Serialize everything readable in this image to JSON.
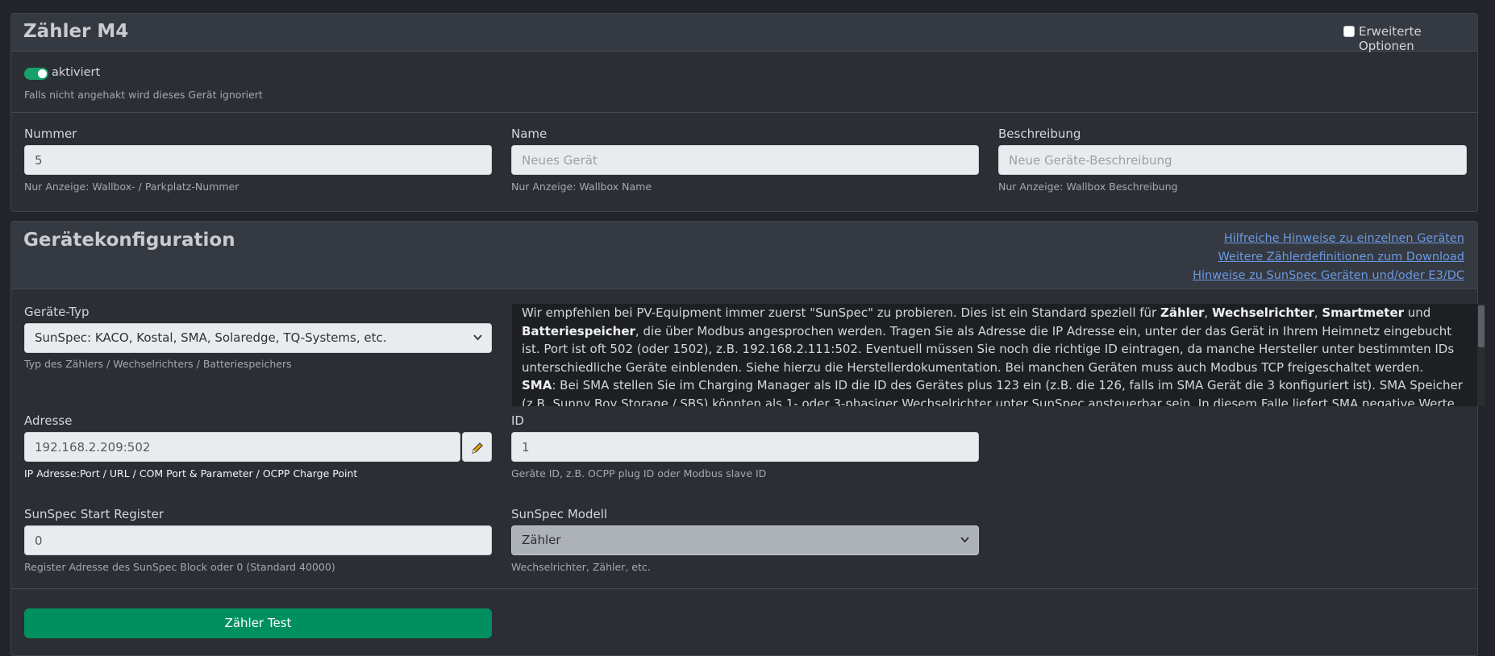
{
  "card1": {
    "title": "Zähler M4",
    "advanced_label": "Erweiterte Optionen",
    "enabled_label": "aktiviert",
    "enabled_hint": "Falls nicht angehakt wird dieses Gerät ignoriert",
    "nummer": {
      "label": "Nummer",
      "value": "5",
      "hint": "Nur Anzeige: Wallbox- / Parkplatz-Nummer"
    },
    "name": {
      "label": "Name",
      "placeholder": "Neues Gerät",
      "hint": "Nur Anzeige: Wallbox Name"
    },
    "beschreibung": {
      "label": "Beschreibung",
      "placeholder": "Neue Geräte-Beschreibung",
      "hint": "Nur Anzeige: Wallbox Beschreibung"
    }
  },
  "card2": {
    "title": "Gerätekonfiguration",
    "links": [
      "Hilfreiche Hinweise zu einzelnen Geräten",
      "Weitere Zählerdefinitionen zum Download",
      "Hinweise zu SunSpec Geräten und/oder E3/DC"
    ],
    "geraetetyp": {
      "label": "Geräte-Typ",
      "value": "SunSpec: KACO, Kostal, SMA, Solaredge, TQ-Systems, etc.",
      "hint": "Typ des Zählers / Wechselrichters / Batteriespeichers"
    },
    "info": {
      "p1_a": "Wir empfehlen bei PV-Equipment immer zuerst \"SunSpec\" zu probieren. Dies ist ein Standard speziell für ",
      "b1": "Zähler",
      "sep1": ", ",
      "b2": "Wechselrichter",
      "sep2": ", ",
      "b3": "Smartmeter",
      "p1_b": " und ",
      "b4": "Batteriespeicher",
      "p1_c": ", die über Modbus angesprochen werden. Tragen Sie als Adresse die IP Adresse ein, unter der das Gerät in Ihrem Heimnetz eingebucht ist. Port ist oft 502 (oder 1502), z.B. 192.168.2.111:502. Eventuell müssen Sie noch die richtige ID eintragen, da manche Hersteller unter bestimmten IDs unterschiedliche Geräte einblenden. Siehe hierzu die Herstellerdokumentation. Bei manchen Geräten muss auch Modbus TCP freigeschaltet werden.",
      "b5": "SMA",
      "p2": ": Bei SMA stellen Sie im Charging Manager als ID die ID des Gerätes plus 123 ein (z.B. die 126, falls im SMA Gerät die 3 konfiguriert ist). SMA Speicher (z.B. Sunny Boy Storage / SBS) könnten als 1- oder 3-phasiger Wechselrichter unter SunSpec ansteuerbar sein. In diesem Falle liefert SMA negative Werte beim Aufladen und positive beim"
    },
    "adresse": {
      "label": "Adresse",
      "value": "192.168.2.209:502",
      "hint": "IP Adresse:Port / URL / COM Port & Parameter / OCPP Charge Point"
    },
    "id": {
      "label": "ID",
      "value": "1",
      "hint": "Geräte ID, z.B. OCPP plug ID oder Modbus slave ID"
    },
    "start_register": {
      "label": "SunSpec Start Register",
      "value": "0",
      "hint": "Register Adresse des SunSpec Block oder 0 (Standard 40000)"
    },
    "modell": {
      "label": "SunSpec Modell",
      "value": "Zähler",
      "hint": "Wechselrichter, Zähler, etc."
    },
    "test_button": "Zähler Test"
  },
  "icons": {
    "dropdown": "chevron-down-icon",
    "edit": "pencil-icon"
  },
  "colors": {
    "accent_green": "#00905f",
    "link": "#6a9ae3",
    "background": "#222429"
  }
}
